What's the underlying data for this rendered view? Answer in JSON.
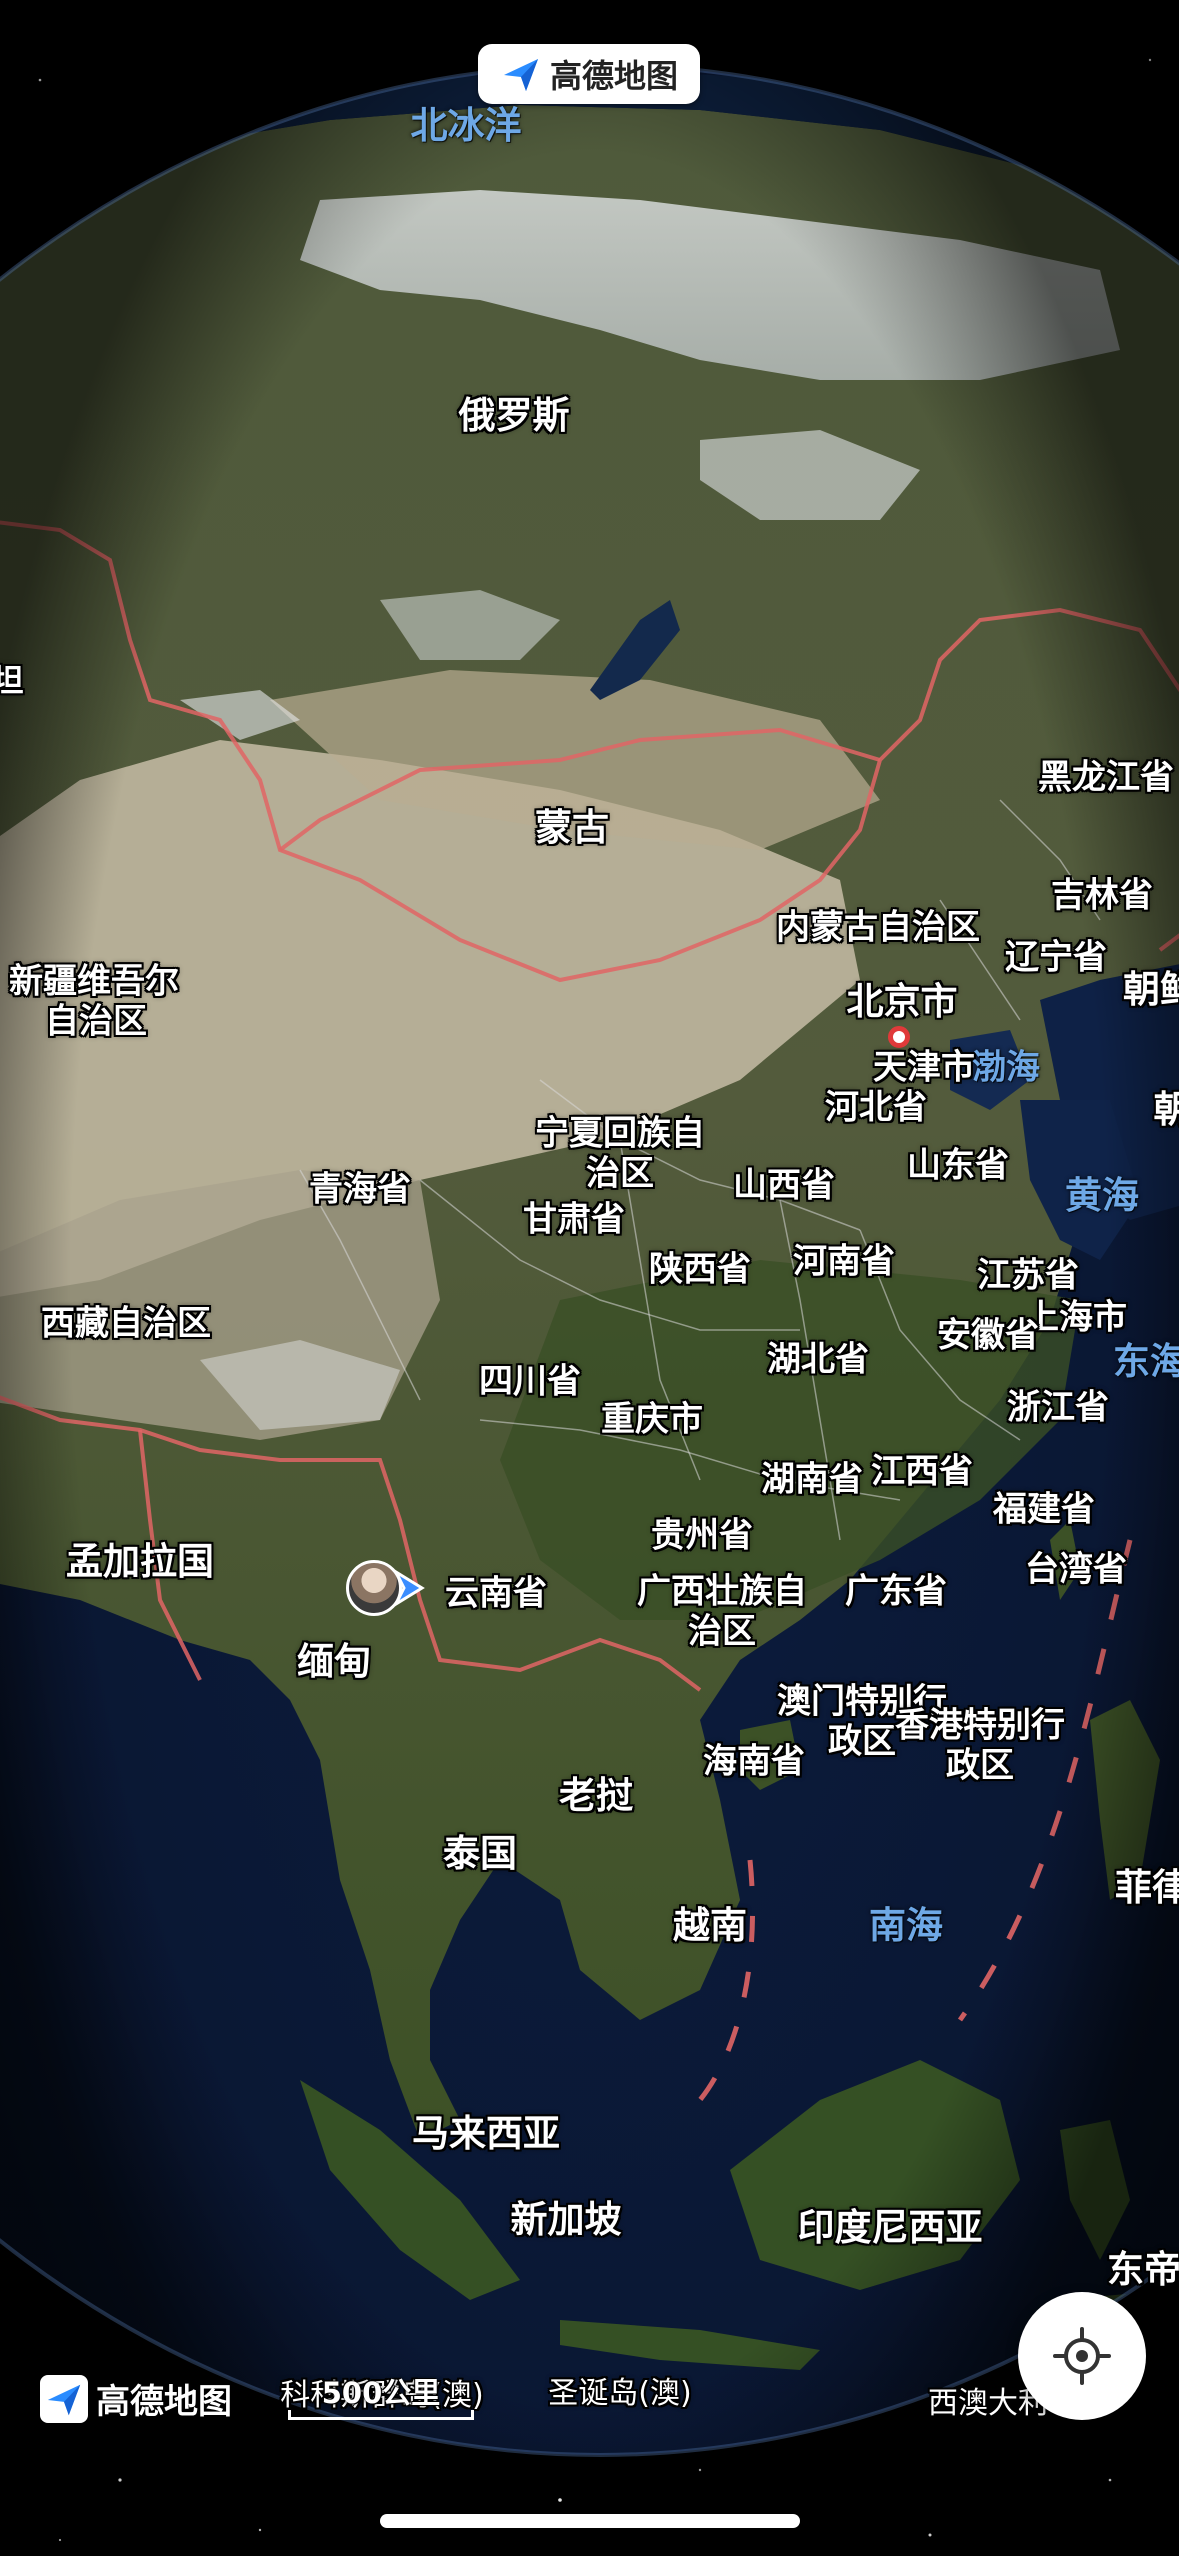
{
  "app": {
    "brand_name": "高德地图"
  },
  "map": {
    "view": "satellite-globe",
    "labels": {
      "north_ice_ocean": "北冰洋",
      "russia": "俄罗斯",
      "mongolia": "蒙古",
      "heilongjiang": "黑龙江省",
      "jilin": "吉林省",
      "liaoning": "辽宁省",
      "inner_mongolia": "内蒙古自治区",
      "beijing": "北京市",
      "tianjin": "天津市",
      "bohai": "渤海",
      "hebei": "河北省",
      "xinjiang_line1": "新疆维吾尔",
      "xinjiang_line2": "自治区",
      "ningxia_line1": "宁夏回族自",
      "ningxia_line2": "治区",
      "qinghai": "青海省",
      "gansu": "甘肃省",
      "shanxi": "山西省",
      "shandong": "山东省",
      "yellow_sea": "黄海",
      "shaanxi": "陕西省",
      "henan": "河南省",
      "jiangsu": "江苏省",
      "shanghai": "上海市",
      "east_sea_partial": "东海",
      "tibet": "西藏自治区",
      "anhui": "安徽省",
      "hubei": "湖北省",
      "sichuan": "四川省",
      "zhejiang": "浙江省",
      "chongqing": "重庆市",
      "hunan": "湖南省",
      "jiangxi": "江西省",
      "fujian": "福建省",
      "guizhou": "贵州省",
      "taiwan": "台湾省",
      "bangladesh": "孟加拉国",
      "yunnan": "云南省",
      "guangxi_line1": "广西壮族自",
      "guangxi_line2": "治区",
      "guangdong": "广东省",
      "myanmar": "缅甸",
      "macau_line1": "澳门特别行",
      "macau_line2": "政区",
      "hongkong_line1": "香港特别行",
      "hongkong_line2": "政区",
      "hainan": "海南省",
      "laos": "老挝",
      "thailand": "泰国",
      "philippines_partial": "菲律",
      "vietnam": "越南",
      "south_sea": "南海",
      "malaysia": "马来西亚",
      "singapore": "新加坡",
      "indonesia": "印度尼西亚",
      "east_timor_partial": "东帝",
      "cocos_partial": "科科斯群岛(澳)",
      "christmas_island": "圣诞岛(澳)",
      "western_australia_partial": "西澳大利",
      "korea_partial_1": "朝鲜",
      "korea_partial_2": "朝",
      "left_edge_partial": "坦"
    },
    "scale_label": "500公里"
  },
  "controls": {
    "locate_icon": "crosshair-icon"
  }
}
